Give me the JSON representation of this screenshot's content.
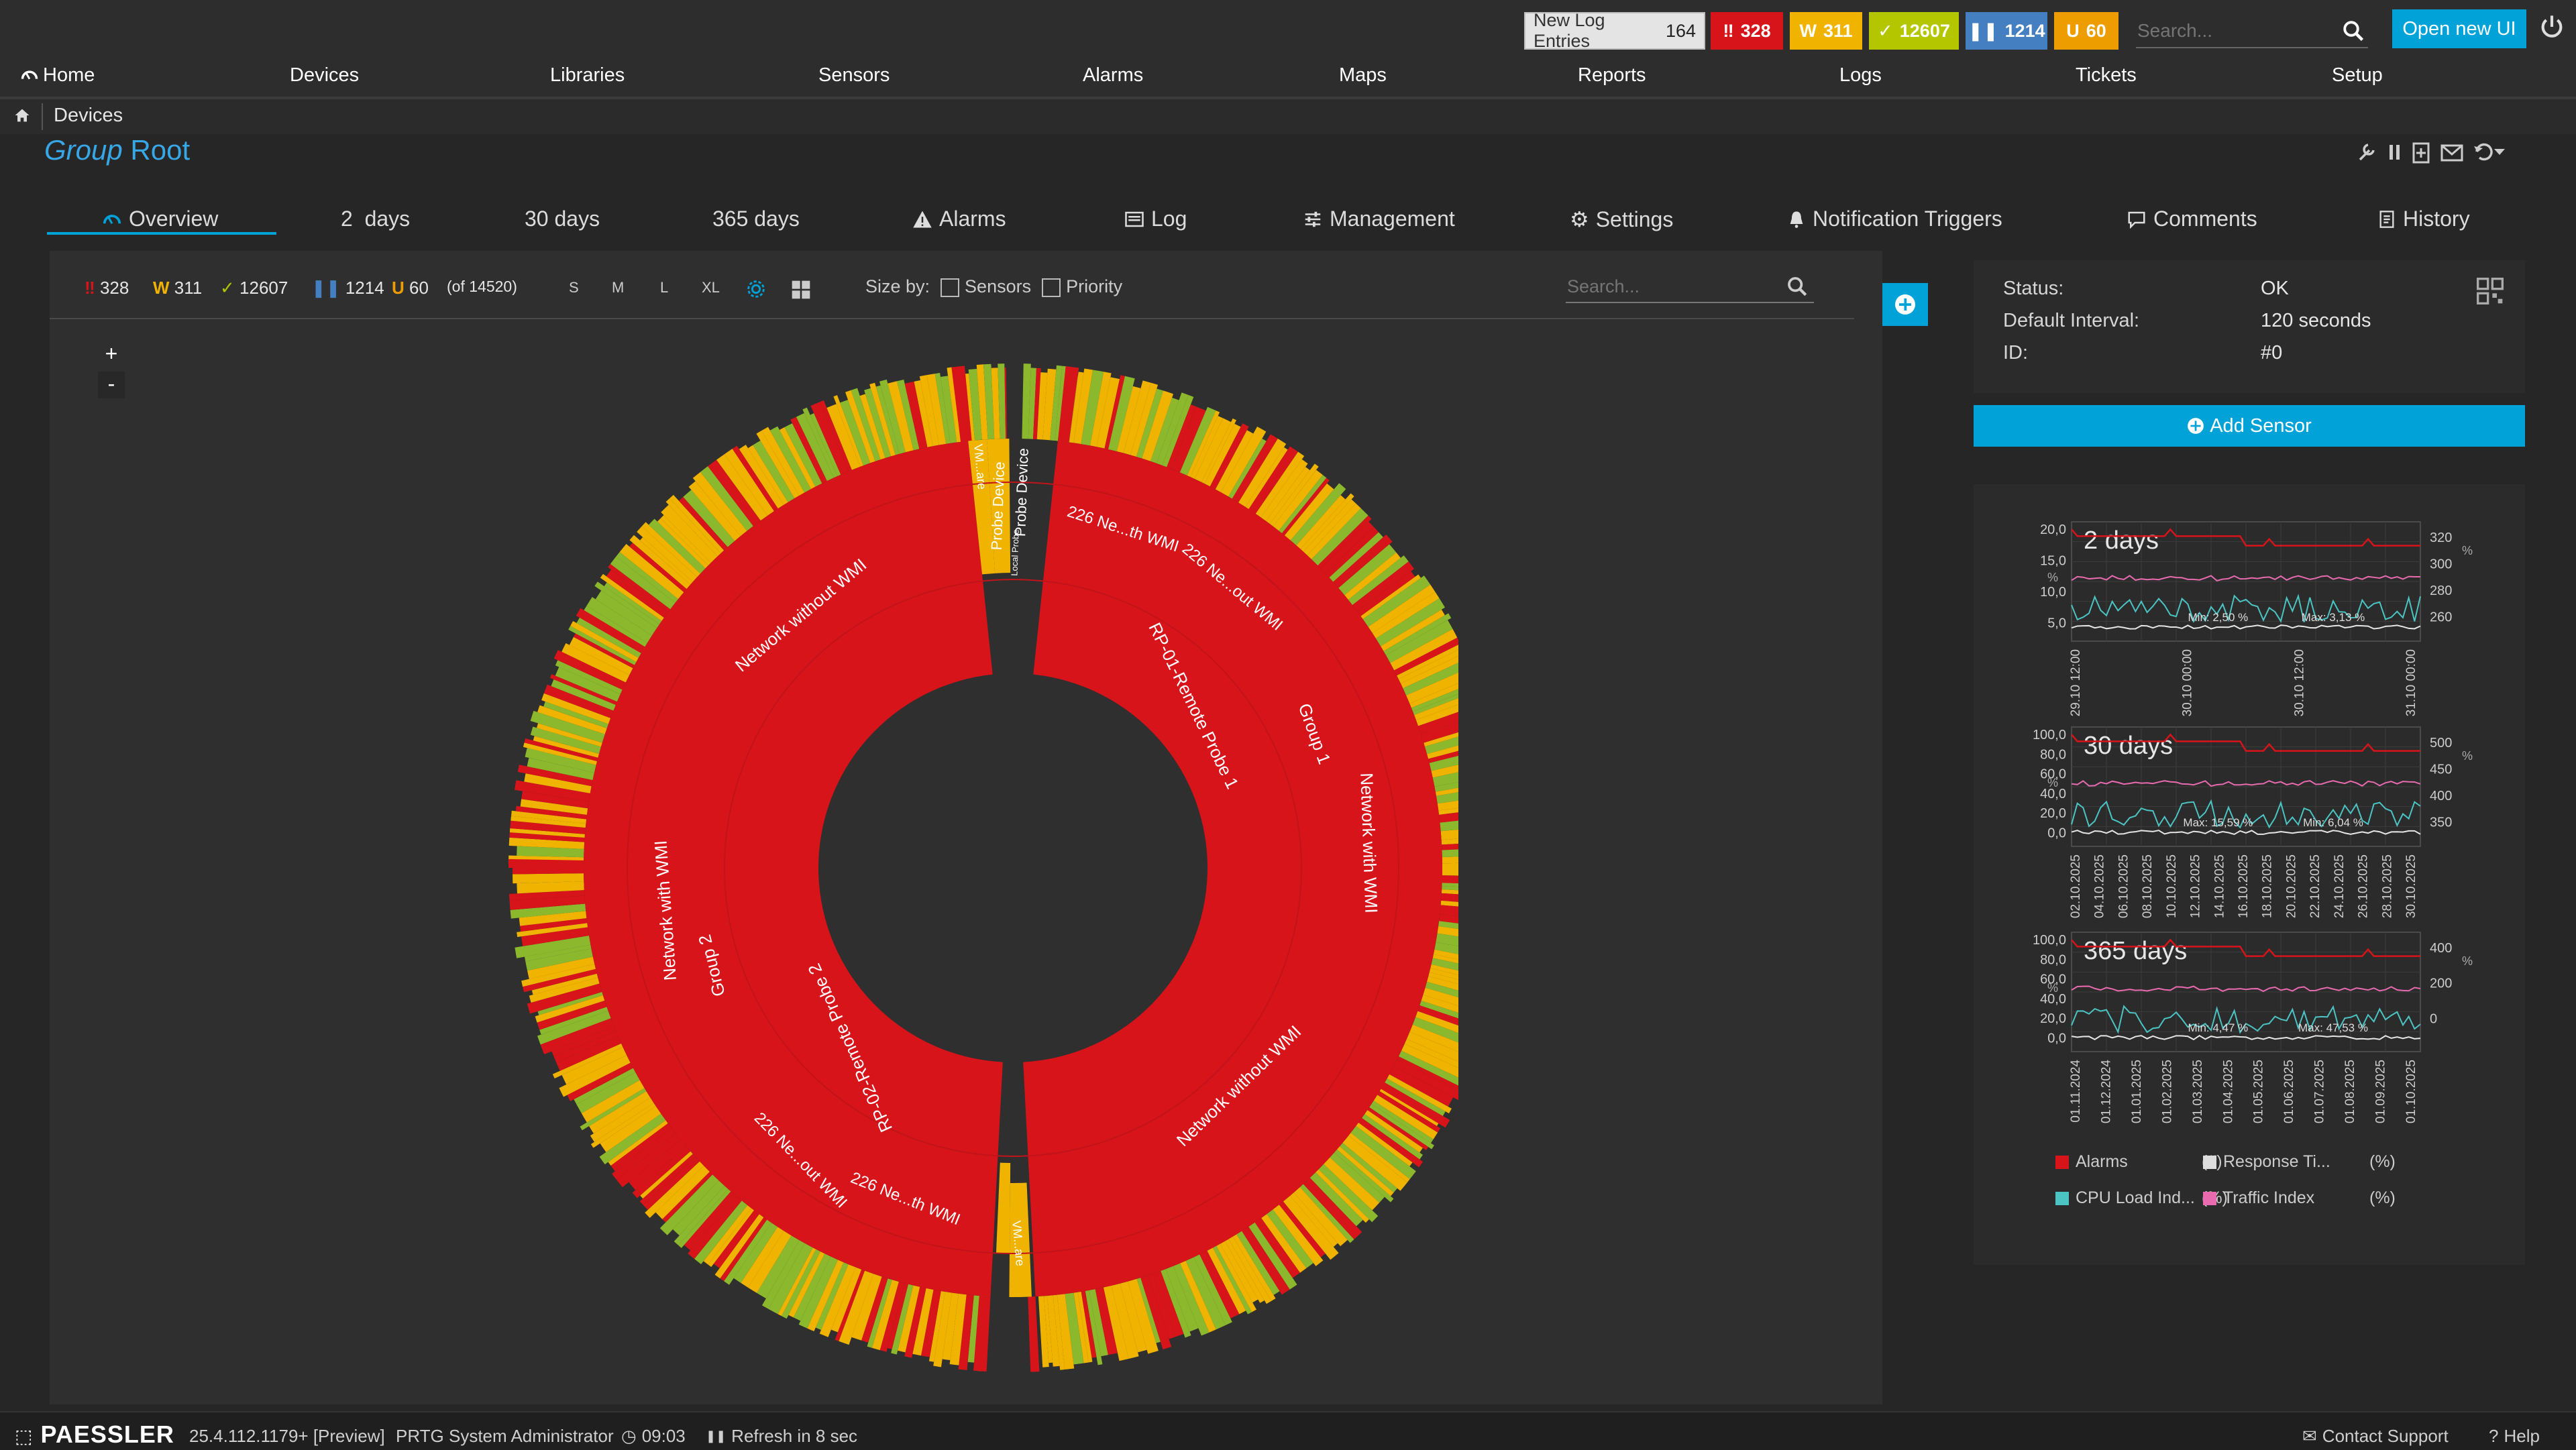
{
  "topbar": {
    "new_log_label": "New Log Entries",
    "new_log_count": "164",
    "down_count": "328",
    "warning_count": "311",
    "ok_count": "12607",
    "paused_count": "1214",
    "unusual_count": "60",
    "search_placeholder": "Search...",
    "open_new_ui": "Open new UI"
  },
  "nav": {
    "items": [
      "Home",
      "Devices",
      "Libraries",
      "Sensors",
      "Alarms",
      "Maps",
      "Reports",
      "Logs",
      "Tickets",
      "Setup"
    ]
  },
  "breadcrumb": {
    "current": "Devices"
  },
  "page": {
    "title_prefix": "Group",
    "title_name": "Root"
  },
  "tabs": [
    "Overview",
    "2  days",
    "30 days",
    "365 days",
    "Alarms",
    "Log",
    "Management",
    "Settings",
    "Notification Triggers",
    "Comments",
    "History"
  ],
  "toolbar": {
    "down": "328",
    "warning": "311",
    "ok": "12607",
    "paused": "1214",
    "unusual": "60",
    "total": "(of 14520)",
    "sizes": [
      "S",
      "M",
      "L",
      "XL"
    ],
    "size_by_label": "Size by:",
    "size_sensors": "Sensors",
    "size_priority": "Priority",
    "search_placeholder": "Search..."
  },
  "zoom": {
    "in": "+",
    "out": "-"
  },
  "sunburst": {
    "inner_labels": [
      "RP-01-Remote Probe 1",
      "RP-02-Remote Probe 2"
    ],
    "mid_labels": [
      "Group 1",
      "Group 2",
      "Network with WMI",
      "Network without WMI",
      "Network with WMI",
      "Network without WMI"
    ],
    "outer_labels": [
      "226 Ne...th WMI",
      "226 Ne...out WMI",
      "226 Ne...th WMI",
      "226 Ne...out WMI",
      "Probe Device",
      "Probe Device",
      "Local Probe",
      "VM...are",
      "VM...are"
    ]
  },
  "info": {
    "status_label": "Status:",
    "status_value": "OK",
    "interval_label": "Default Interval:",
    "interval_value": "120 seconds",
    "id_label": "ID:",
    "id_value": "#0",
    "add_sensor": "Add Sensor"
  },
  "graphs": {
    "g1_title": "2 days",
    "g1_yleft": [
      "20,0",
      "15,0",
      "10,0",
      "5,0"
    ],
    "g1_yright": [
      "320",
      "300",
      "280",
      "260"
    ],
    "g1_x": [
      "29.10 12:00",
      "30.10 00:00",
      "30.10 12:00",
      "31.10 00:00"
    ],
    "g1_min": "Min: 2,50 %",
    "g1_max": "Max: 3,13 %",
    "g2_title": "30 days",
    "g2_yleft": [
      "100,0",
      "80,0",
      "60,0",
      "40,0",
      "20,0",
      "0,0"
    ],
    "g2_yright": [
      "500",
      "450",
      "400",
      "350"
    ],
    "g2_x": [
      "02.10.2025",
      "04.10.2025",
      "06.10.2025",
      "08.10.2025",
      "10.10.2025",
      "12.10.2025",
      "14.10.2025",
      "16.10.2025",
      "18.10.2025",
      "20.10.2025",
      "22.10.2025",
      "24.10.2025",
      "26.10.2025",
      "28.10.2025",
      "30.10.2025"
    ],
    "g2_max": "Max: 15,59 %",
    "g2_min": "Min: 6,04 %",
    "g3_title": "365 days",
    "g3_yleft": [
      "100,0",
      "80,0",
      "60,0",
      "40,0",
      "20,0",
      "0,0"
    ],
    "g3_yright": [
      "400",
      "200",
      "0"
    ],
    "g3_x": [
      "01.11.2024",
      "01.12.2024",
      "01.01.2025",
      "01.02.2025",
      "01.03.2025",
      "01.04.2025",
      "01.05.2025",
      "01.06.2025",
      "01.07.2025",
      "01.08.2025",
      "01.09.2025",
      "01.10.2025"
    ],
    "g3_min": "Min: 4,47 %",
    "g3_max": "Max: 47,53 %",
    "unit_pct": "%",
    "legend": [
      {
        "name": "Alarms",
        "unit": "(#)",
        "color": "#d7141a"
      },
      {
        "name": "Response Ti...",
        "unit": "(%)",
        "color": "#dddddd"
      },
      {
        "name": "CPU Load Ind...",
        "unit": "(%)",
        "color": "#4cc4c4"
      },
      {
        "name": "Traffic Index",
        "unit": "(%)",
        "color": "#e86bb0"
      }
    ]
  },
  "footer": {
    "brand": "PAESSLER",
    "version": "25.4.112.1179+ [Preview]",
    "user": "PRTG System Administrator",
    "time": "09:03",
    "refresh": "Refresh in 8 sec",
    "contact": "Contact Support",
    "help": "Help"
  },
  "colors": {
    "accent": "#00a2d8",
    "down": "#d7141a",
    "warning": "#f0b400",
    "ok": "#b3c600",
    "paused": "#447fc1",
    "unusual": "#ee9d00"
  }
}
